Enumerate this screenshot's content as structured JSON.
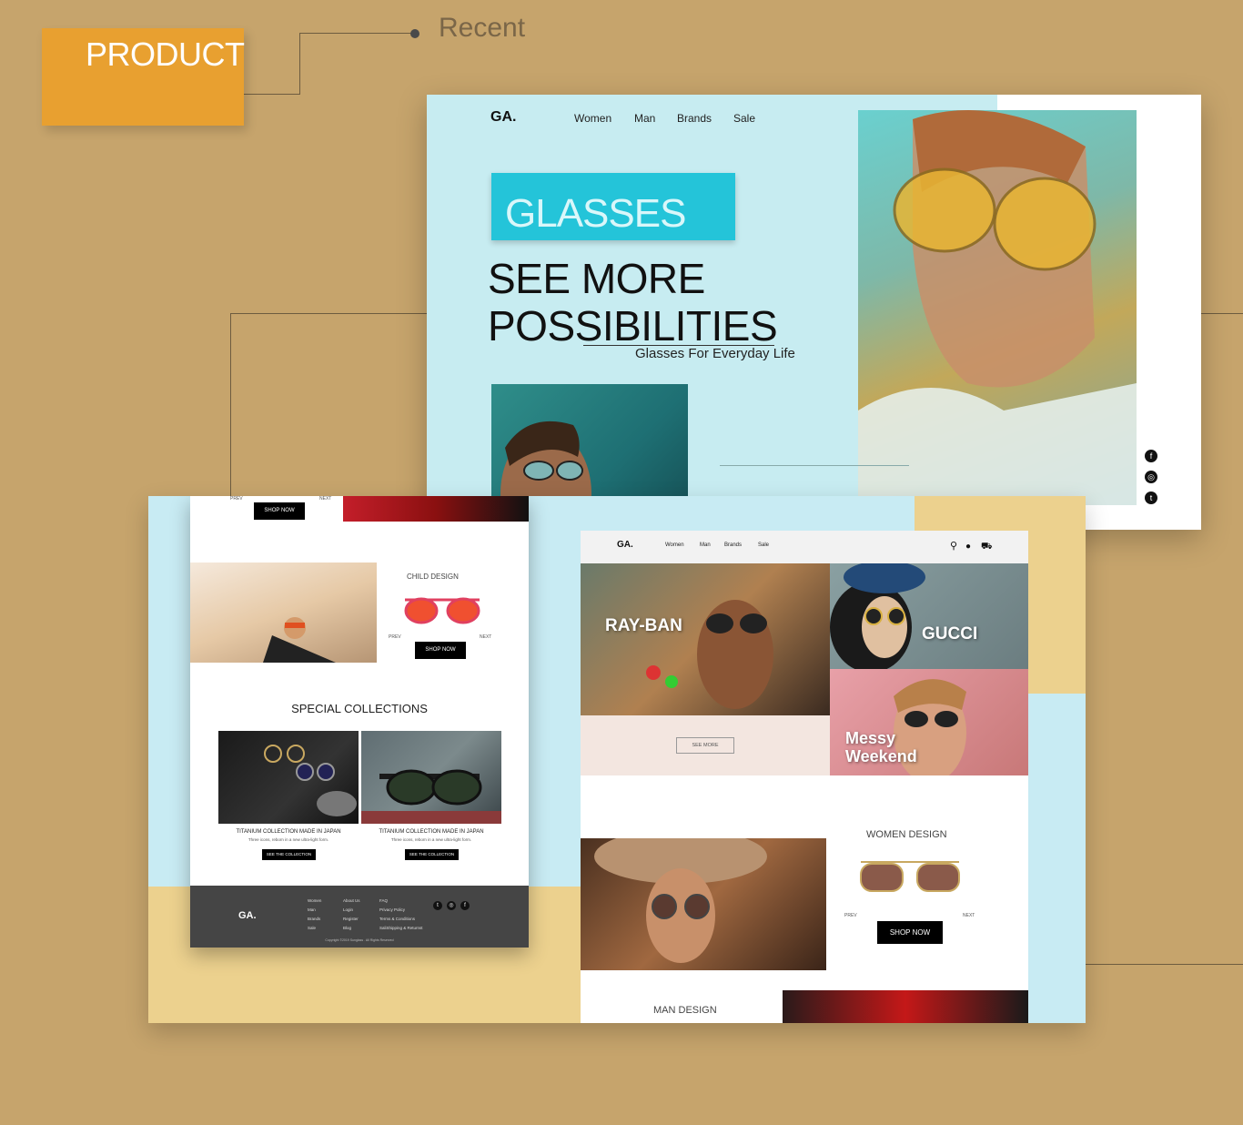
{
  "badge": {
    "label": "PRODUCT"
  },
  "recent": {
    "label": "Recent"
  },
  "hero": {
    "logo": "GA.",
    "nav": [
      "Women",
      "Man",
      "Brands",
      "Sale"
    ],
    "glasses_label": "GLASSES",
    "headline_line1": "SEE MORE",
    "headline_line2": "POSSIBILITIES",
    "subtitle": "Glasses For Everyday Life",
    "social_icons": [
      "facebook-icon",
      "instagram-icon",
      "twitter-icon"
    ]
  },
  "left_page": {
    "top_shop_now": "SHOP NOW",
    "top_prev": "PREV",
    "top_next": "NEXT",
    "child_design_title": "CHILD DESIGN",
    "child_prev": "PREV",
    "child_next": "NEXT",
    "child_shop_now": "SHOP NOW",
    "special_title": "SPECIAL COLLECTIONS",
    "collections": [
      {
        "title": "TITANIUM COLLECTION MADE IN JAPAN",
        "desc": "Three icons, reborn in a new ultra-light form.",
        "button": "SEE THE COLLECTION"
      },
      {
        "title": "TITANIUM COLLECTION MADE IN JAPAN",
        "desc": "Three icons, reborn in a new ultra-light form.",
        "button": "SEE THE COLLECTION"
      }
    ],
    "footer": {
      "logo": "GA.",
      "col1": [
        "Women",
        "Man",
        "Brands",
        "Sale"
      ],
      "col2": [
        "About Us",
        "Login",
        "Register",
        "Blog"
      ],
      "col3": [
        "FAQ",
        "Privacy Policy",
        "Terms & Conditions",
        "SaliShipping & Returnst"
      ],
      "copyright": "Copyright ©2019 Sunglass . All Rights Reserved"
    }
  },
  "right_page": {
    "logo": "GA.",
    "nav": [
      "Women",
      "Man",
      "Brands",
      "Sale"
    ],
    "brand_rayban": "RAY-BAN",
    "brand_gucci": "GUCCI",
    "brand_messy1": "Messy",
    "brand_messy2": "Weekend",
    "see_more": "SEE MORE",
    "women_design_title": "WOMEN DESIGN",
    "women_prev": "PREV",
    "women_next": "NEXT",
    "women_shop_now": "SHOP NOW",
    "man_design_title": "MAN DESIGN"
  }
}
